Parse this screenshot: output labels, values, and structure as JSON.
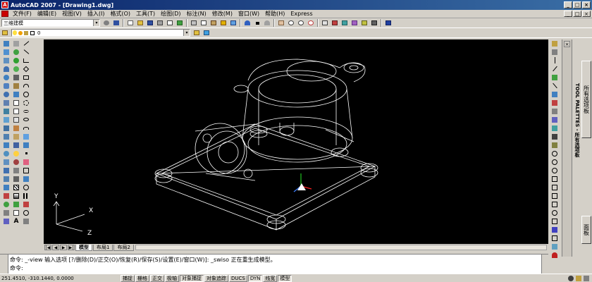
{
  "window": {
    "app_icon": "A",
    "title": "AutoCAD 2007 - [Drawing1.dwg]",
    "minimize": "_",
    "maximize": "□",
    "close": "×"
  },
  "menu": {
    "items": [
      "文件(F)",
      "编辑(E)",
      "视图(V)",
      "插入(I)",
      "格式(O)",
      "工具(T)",
      "绘图(D)",
      "标注(N)",
      "修改(M)",
      "窗口(W)",
      "帮助(H)",
      "Express"
    ],
    "doc_min": "_",
    "doc_restore": "□",
    "doc_close": "×"
  },
  "toolbar": {
    "workspace": "三维建模",
    "layer": "0",
    "dropdown_arrow": "▾"
  },
  "left_toolbar": {
    "text_tool": "A"
  },
  "palette": {
    "close": "×",
    "title": "TOOL PALETTES - 所有选项板",
    "tab_top": "所有选项板",
    "tab_bottom": "面板"
  },
  "layout_tabs": {
    "nav": [
      "|◀",
      "◀",
      "▶",
      "▶|"
    ],
    "tabs": [
      "模型",
      "布局1",
      "布局2"
    ],
    "active": "模型"
  },
  "ucs": {
    "x_label": "X",
    "y_label": "Y",
    "z_label": "Z"
  },
  "command": {
    "line1": "命令: _-view 输入选项 [?/删除(D)/正交(O)/恢复(R)/保存(S)/设置(E)/窗口(W)]: _swiso 正在重生成模型。",
    "line2": "命令:"
  },
  "status": {
    "coords": "251.4510,  -310.1440,  0.0000",
    "buttons": [
      "捕捉",
      "栅格",
      "正交",
      "极轴",
      "对象捕捉",
      "对象追踪",
      "DUCS",
      "DYN",
      "线宽",
      "模型"
    ],
    "on_buttons": [
      "对象捕捉",
      "DYN",
      "模型"
    ]
  },
  "colors": {
    "title_start": "#0a246a",
    "title_end": "#3a6ea5",
    "canvas": "#000000",
    "wireframe": "#ffffff",
    "ucs_red": "#ff2020",
    "ucs_green": "#20c020",
    "ucs_blue": "#4080ff"
  }
}
